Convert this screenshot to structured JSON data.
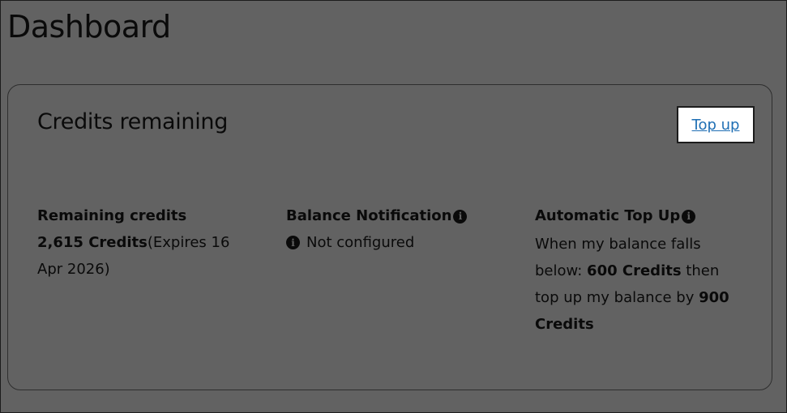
{
  "page": {
    "title": "Dashboard"
  },
  "card": {
    "title": "Credits remaining",
    "topup_label": "Top up",
    "remaining": {
      "heading": "Remaining credits",
      "amount": "2,615 Credits",
      "expiry": "(Expires 16 Apr 2026)"
    },
    "balance_notification": {
      "heading": "Balance Notification",
      "status": "Not configured"
    },
    "auto_topup": {
      "heading": "Automatic Top Up",
      "text_before_threshold": "When my balance falls below: ",
      "threshold": "600 Credits",
      "text_before_amount": " then top up my balance by ",
      "amount": "900 Credits"
    }
  },
  "icons": {
    "info": "info-icon"
  },
  "colors": {
    "background": "#626262",
    "link": "#1f6fb4",
    "button_bg": "#ffffff"
  }
}
